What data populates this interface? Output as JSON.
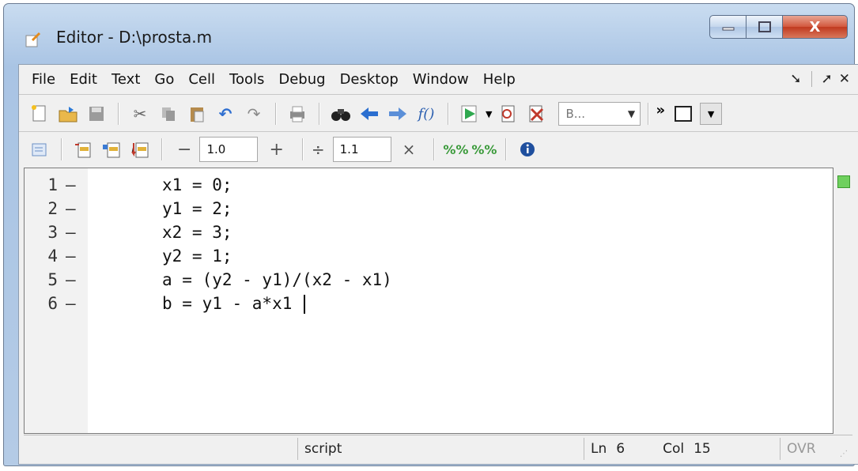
{
  "window": {
    "title": "Editor - D:\\prosta.m",
    "minimize_label": "—",
    "maximize_label": "☐",
    "close_label": "X"
  },
  "menu": {
    "items": [
      "File",
      "Edit",
      "Text",
      "Go",
      "Cell",
      "Tools",
      "Debug",
      "Desktop",
      "Window",
      "Help"
    ],
    "right_controls": [
      "undock-icon",
      "maximize-icon",
      "close-icon"
    ]
  },
  "toolbar1": {
    "stack_combo": "B...",
    "more_label": "»"
  },
  "toolbar2": {
    "decrement_label": "−",
    "increment_value": "1.0",
    "increment_label": "+",
    "divide_label": "÷",
    "divide_value": "1.1",
    "multiply_label": "×"
  },
  "editor": {
    "lines": [
      {
        "number": "1",
        "marker": "–",
        "code": "x1 = 0;"
      },
      {
        "number": "2",
        "marker": "–",
        "code": "y1 = 2;"
      },
      {
        "number": "3",
        "marker": "–",
        "code": "x2 = 3;"
      },
      {
        "number": "4",
        "marker": "–",
        "code": "y2 = 1;"
      },
      {
        "number": "5",
        "marker": "–",
        "code": "a = (y2 - y1)/(x2 - x1)"
      },
      {
        "number": "6",
        "marker": "–",
        "code": "b = y1 - a*x1 "
      }
    ],
    "status_indicator_color": "#6fd05e"
  },
  "status": {
    "mode": "script",
    "line_label": "Ln",
    "line_value": "6",
    "col_label": "Col",
    "col_value": "15",
    "ovr": "OVR"
  },
  "colors": {
    "frame": "#b9d0ea",
    "close_button": "#c0391f",
    "run_green": "#2fa84f"
  }
}
